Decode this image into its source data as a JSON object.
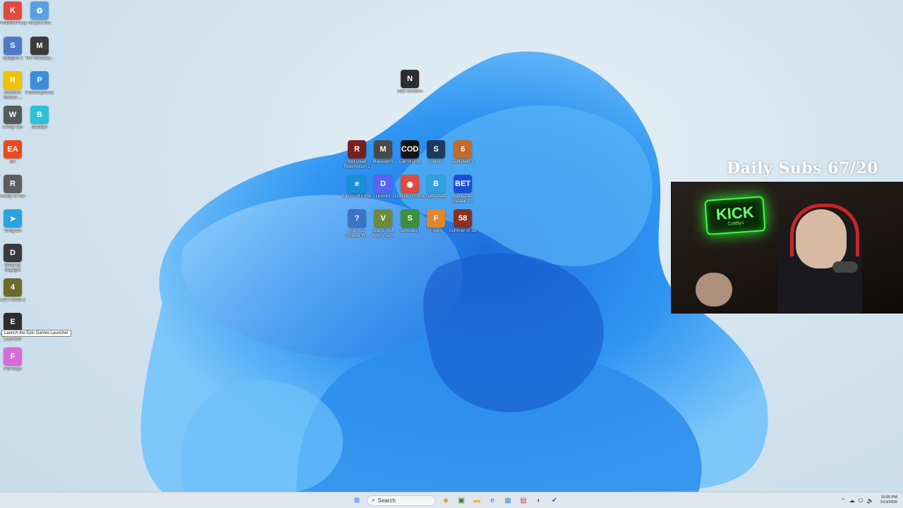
{
  "overlay": {
    "subs_text": "Daily Subs 67/20"
  },
  "webcam": {
    "sign_text": "KICK",
    "sign_sub": "Coldlys"
  },
  "desktop_icons_left": [
    {
      "label": "FortBlockParty",
      "name": "fortblockparty",
      "color": "#e24b3b",
      "glyph": "K"
    },
    {
      "label": "Recycle Bin",
      "name": "recycle-bin",
      "color": "#5aa0e6",
      "glyph": "♻"
    },
    {
      "label": "Splitgate 2",
      "name": "splitgate-2",
      "color": "#4c7ac8",
      "glyph": "S"
    },
    {
      "label": "The Mortuary...",
      "name": "the-mortuary",
      "color": "#3b3b3b",
      "glyph": "M"
    },
    {
      "label": "Rockstar Games ...",
      "name": "rockstar-games",
      "color": "#f2c200",
      "glyph": "R"
    },
    {
      "label": "Phasmophobia",
      "name": "phasmophobia",
      "color": "#3a8fd9",
      "glyph": "P"
    },
    {
      "label": "A Way Out",
      "name": "a-way-out",
      "color": "#555b5c",
      "glyph": "W"
    },
    {
      "label": "BattlEye",
      "name": "battleye",
      "color": "#29c2d6",
      "glyph": "B"
    },
    {
      "label": "EA",
      "name": "ea",
      "color": "#ea4b1e",
      "glyph": "EA"
    },
    {
      "label": "Ready or Not",
      "name": "ready-or-not",
      "color": "#5e5e5e",
      "glyph": "R"
    },
    {
      "label": "Telegram",
      "name": "telegram",
      "color": "#2aa3e0",
      "glyph": "➤"
    },
    {
      "label": "Dead by Daylight",
      "name": "dead-by-daylight",
      "color": "#3a3a3a",
      "glyph": "D"
    },
    {
      "label": "Left 4 Dead 2",
      "name": "left-4-dead-2",
      "color": "#6a6a2a",
      "glyph": "4"
    },
    {
      "label": "Epic Games Launcher",
      "name": "epic-games-launcher",
      "color": "#2d2d2d",
      "glyph": "E"
    },
    {
      "label": "Fall Guys",
      "name": "fall-guys",
      "color": "#d86bd8",
      "glyph": "F"
    }
  ],
  "tooltip_text": "Launch the Epic Games Launcher",
  "desktop_icons_center": [
    {
      "label": "NBC Builders",
      "name": "nbc-builders",
      "color": "#2e2e2e",
      "glyph": "N"
    },
    {
      "label": "Red Dead Redemption 2",
      "name": "red-dead-redemption",
      "color": "#7a1f1f",
      "glyph": "R"
    },
    {
      "label": "Marauders",
      "name": "marauders",
      "color": "#4a4a48",
      "glyph": "M"
    },
    {
      "label": "Call of Duty",
      "name": "call-of-duty",
      "color": "#141414",
      "glyph": "COD"
    },
    {
      "label": "Steam",
      "name": "steam",
      "color": "#1f3a5a",
      "glyph": "S"
    },
    {
      "label": "Battlefield 6",
      "name": "battlefield-6",
      "color": "#c26b2c",
      "glyph": "6"
    },
    {
      "label": "Microsoft Edge",
      "name": "microsoft-edge",
      "color": "#1b8fd6",
      "glyph": "e"
    },
    {
      "label": "Discord",
      "name": "discord",
      "color": "#5865f2",
      "glyph": "D"
    },
    {
      "label": "Google Chrome",
      "name": "google-chrome",
      "color": "#dd4b3e",
      "glyph": "◉"
    },
    {
      "label": "Battlestate",
      "name": "battlestate",
      "color": "#2f9fe0",
      "glyph": "B"
    },
    {
      "label": "Battlestate Escape fr...",
      "name": "battlestate-escape",
      "color": "#1d4fd6",
      "glyph": "BET"
    },
    {
      "label": "Are You Smarter th...",
      "name": "are-you-smarter",
      "color": "#3a74c6",
      "glyph": "?"
    },
    {
      "label": "Grand Theft Auto V Le...",
      "name": "grand-theft-auto-v",
      "color": "#6f8a3a",
      "glyph": "V"
    },
    {
      "label": "Schedule I",
      "name": "schedule-i",
      "color": "#3c8f3c",
      "glyph": "S"
    },
    {
      "label": "FiveM",
      "name": "fivem",
      "color": "#e2862d",
      "glyph": "F"
    },
    {
      "label": "Summer of '58",
      "name": "summer-of-58",
      "color": "#8a2f22",
      "glyph": "58"
    }
  ],
  "taskbar": {
    "search_placeholder": "Search",
    "apps": [
      {
        "name": "start-button",
        "glyph": "⊞",
        "color": "#1a73e8"
      },
      {
        "name": "widgets-icon",
        "glyph": "◆",
        "color": "#d9a13a"
      },
      {
        "name": "xbox-icon",
        "glyph": "▣",
        "color": "#2e7d32"
      },
      {
        "name": "file-explorer-icon",
        "glyph": "▬",
        "color": "#f1b42f"
      },
      {
        "name": "edge-icon",
        "glyph": "e",
        "color": "#1b8fd6"
      },
      {
        "name": "store-icon",
        "glyph": "▦",
        "color": "#3a8fd9"
      },
      {
        "name": "app-icon-red",
        "glyph": "▤",
        "color": "#d9483b"
      },
      {
        "name": "app-icon-purple",
        "glyph": "◐",
        "color": "#7a4fd6"
      },
      {
        "name": "app-icon-blue",
        "glyph": "✔",
        "color": "#1b6fd6"
      }
    ],
    "time": "10:55 PM",
    "date": "1/14/2026"
  }
}
